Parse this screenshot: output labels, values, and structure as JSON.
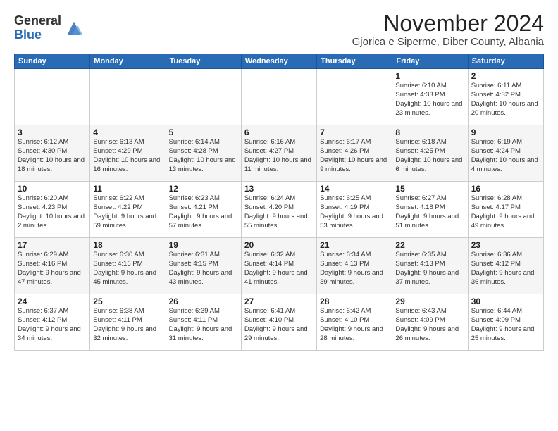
{
  "header": {
    "logo_general": "General",
    "logo_blue": "Blue",
    "month_title": "November 2024",
    "location": "Gjorica e Siperme, Diber County, Albania"
  },
  "weekdays": [
    "Sunday",
    "Monday",
    "Tuesday",
    "Wednesday",
    "Thursday",
    "Friday",
    "Saturday"
  ],
  "weeks": [
    [
      {
        "day": "",
        "info": ""
      },
      {
        "day": "",
        "info": ""
      },
      {
        "day": "",
        "info": ""
      },
      {
        "day": "",
        "info": ""
      },
      {
        "day": "",
        "info": ""
      },
      {
        "day": "1",
        "info": "Sunrise: 6:10 AM\nSunset: 4:33 PM\nDaylight: 10 hours and 23 minutes."
      },
      {
        "day": "2",
        "info": "Sunrise: 6:11 AM\nSunset: 4:32 PM\nDaylight: 10 hours and 20 minutes."
      }
    ],
    [
      {
        "day": "3",
        "info": "Sunrise: 6:12 AM\nSunset: 4:30 PM\nDaylight: 10 hours and 18 minutes."
      },
      {
        "day": "4",
        "info": "Sunrise: 6:13 AM\nSunset: 4:29 PM\nDaylight: 10 hours and 16 minutes."
      },
      {
        "day": "5",
        "info": "Sunrise: 6:14 AM\nSunset: 4:28 PM\nDaylight: 10 hours and 13 minutes."
      },
      {
        "day": "6",
        "info": "Sunrise: 6:16 AM\nSunset: 4:27 PM\nDaylight: 10 hours and 11 minutes."
      },
      {
        "day": "7",
        "info": "Sunrise: 6:17 AM\nSunset: 4:26 PM\nDaylight: 10 hours and 9 minutes."
      },
      {
        "day": "8",
        "info": "Sunrise: 6:18 AM\nSunset: 4:25 PM\nDaylight: 10 hours and 6 minutes."
      },
      {
        "day": "9",
        "info": "Sunrise: 6:19 AM\nSunset: 4:24 PM\nDaylight: 10 hours and 4 minutes."
      }
    ],
    [
      {
        "day": "10",
        "info": "Sunrise: 6:20 AM\nSunset: 4:23 PM\nDaylight: 10 hours and 2 minutes."
      },
      {
        "day": "11",
        "info": "Sunrise: 6:22 AM\nSunset: 4:22 PM\nDaylight: 9 hours and 59 minutes."
      },
      {
        "day": "12",
        "info": "Sunrise: 6:23 AM\nSunset: 4:21 PM\nDaylight: 9 hours and 57 minutes."
      },
      {
        "day": "13",
        "info": "Sunrise: 6:24 AM\nSunset: 4:20 PM\nDaylight: 9 hours and 55 minutes."
      },
      {
        "day": "14",
        "info": "Sunrise: 6:25 AM\nSunset: 4:19 PM\nDaylight: 9 hours and 53 minutes."
      },
      {
        "day": "15",
        "info": "Sunrise: 6:27 AM\nSunset: 4:18 PM\nDaylight: 9 hours and 51 minutes."
      },
      {
        "day": "16",
        "info": "Sunrise: 6:28 AM\nSunset: 4:17 PM\nDaylight: 9 hours and 49 minutes."
      }
    ],
    [
      {
        "day": "17",
        "info": "Sunrise: 6:29 AM\nSunset: 4:16 PM\nDaylight: 9 hours and 47 minutes."
      },
      {
        "day": "18",
        "info": "Sunrise: 6:30 AM\nSunset: 4:16 PM\nDaylight: 9 hours and 45 minutes."
      },
      {
        "day": "19",
        "info": "Sunrise: 6:31 AM\nSunset: 4:15 PM\nDaylight: 9 hours and 43 minutes."
      },
      {
        "day": "20",
        "info": "Sunrise: 6:32 AM\nSunset: 4:14 PM\nDaylight: 9 hours and 41 minutes."
      },
      {
        "day": "21",
        "info": "Sunrise: 6:34 AM\nSunset: 4:13 PM\nDaylight: 9 hours and 39 minutes."
      },
      {
        "day": "22",
        "info": "Sunrise: 6:35 AM\nSunset: 4:13 PM\nDaylight: 9 hours and 37 minutes."
      },
      {
        "day": "23",
        "info": "Sunrise: 6:36 AM\nSunset: 4:12 PM\nDaylight: 9 hours and 36 minutes."
      }
    ],
    [
      {
        "day": "24",
        "info": "Sunrise: 6:37 AM\nSunset: 4:12 PM\nDaylight: 9 hours and 34 minutes."
      },
      {
        "day": "25",
        "info": "Sunrise: 6:38 AM\nSunset: 4:11 PM\nDaylight: 9 hours and 32 minutes."
      },
      {
        "day": "26",
        "info": "Sunrise: 6:39 AM\nSunset: 4:11 PM\nDaylight: 9 hours and 31 minutes."
      },
      {
        "day": "27",
        "info": "Sunrise: 6:41 AM\nSunset: 4:10 PM\nDaylight: 9 hours and 29 minutes."
      },
      {
        "day": "28",
        "info": "Sunrise: 6:42 AM\nSunset: 4:10 PM\nDaylight: 9 hours and 28 minutes."
      },
      {
        "day": "29",
        "info": "Sunrise: 6:43 AM\nSunset: 4:09 PM\nDaylight: 9 hours and 26 minutes."
      },
      {
        "day": "30",
        "info": "Sunrise: 6:44 AM\nSunset: 4:09 PM\nDaylight: 9 hours and 25 minutes."
      }
    ]
  ]
}
